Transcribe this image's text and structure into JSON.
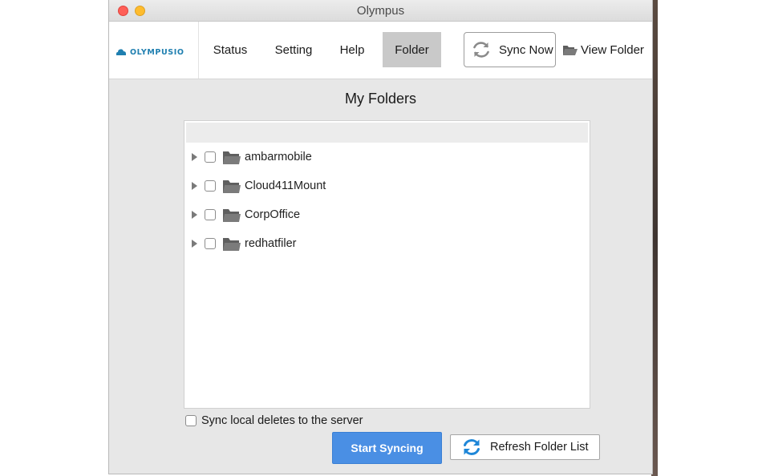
{
  "window": {
    "title": "Olympus"
  },
  "logo": {
    "text": "OLYMPUSIO",
    "color": "#1f7fb0"
  },
  "nav": {
    "items": [
      {
        "label": "Status"
      },
      {
        "label": "Setting"
      },
      {
        "label": "Help"
      },
      {
        "label": "Folder",
        "active": true
      }
    ]
  },
  "toolbar": {
    "sync_now_label": "Sync Now",
    "sync_icon": "sync-icon",
    "view_folder_label": "View Folder",
    "view_folder_icon": "open-folder-icon"
  },
  "main": {
    "title": "My Folders",
    "folders": [
      {
        "name": "ambarmobile",
        "checked": false,
        "expanded": false
      },
      {
        "name": "Cloud411Mount",
        "checked": false,
        "expanded": false
      },
      {
        "name": "CorpOffice",
        "checked": false,
        "expanded": false
      },
      {
        "name": "redhatfiler",
        "checked": false,
        "expanded": false
      }
    ],
    "sync_deletes_label": "Sync local deletes to the server",
    "sync_deletes_checked": false,
    "start_syncing_label": "Start Syncing",
    "refresh_folder_list_label": "Refresh Folder List"
  },
  "colors": {
    "accent": "#4a8fe4",
    "close": "#fe5f57",
    "minimize": "#febc2e",
    "folder_icon": "#6e6e6e",
    "sync_icon_blue": "#1f87d8"
  }
}
